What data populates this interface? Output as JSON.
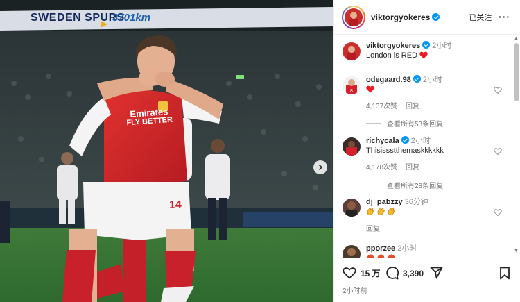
{
  "media": {
    "banner_text": "SWEDEN SPURS",
    "banner_distance": "3701km",
    "shirt_line1": "Emirates",
    "shirt_line2": "FLY BETTER"
  },
  "header": {
    "username": "viktorgyokeres",
    "follow_label": "已关注",
    "more_label": "···"
  },
  "caption": {
    "username": "viktorgyokeres",
    "time": "2小时",
    "text": "London is RED"
  },
  "comments": [
    {
      "username": "odegaard.98",
      "verified": true,
      "time": "2小时",
      "text": "",
      "likes": "4,137次赞",
      "reply": "回复",
      "view_replies": "查看所有53条回复"
    },
    {
      "username": "richycala",
      "verified": true,
      "time": "2小时",
      "text": "Thisissstthemaskkkkkk",
      "likes": "4,178次赞",
      "reply": "回复",
      "view_replies": "查看所有28条回复"
    },
    {
      "username": "dj_pabzzy",
      "verified": false,
      "time": "36分钟",
      "text": "",
      "likes": "",
      "reply": "回复",
      "view_replies": ""
    },
    {
      "username": "pporzee",
      "verified": false,
      "time": "2小时",
      "text": "",
      "likes": "",
      "reply": "",
      "view_replies": ""
    }
  ],
  "actions": {
    "likes_count": "15 万",
    "comments_count": "3,390",
    "timestamp": "2小时前"
  },
  "colors": {
    "arsenal_red": "#d3202a",
    "verified_blue": "#0095f6",
    "heart_red": "#ed1c24"
  }
}
